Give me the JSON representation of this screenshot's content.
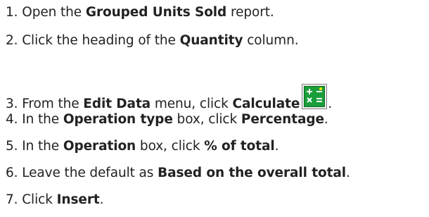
{
  "steps": [
    {
      "number": "1.",
      "parts": [
        {
          "t": "Open the "
        },
        {
          "t": "Grouped Units Sold",
          "b": true
        },
        {
          "t": " report."
        }
      ]
    },
    {
      "number": "2.",
      "parts": [
        {
          "t": "Click the heading of the "
        },
        {
          "t": "Quantity",
          "b": true
        },
        {
          "t": " column."
        }
      ]
    },
    {
      "number": "3.",
      "parts": [
        {
          "t": "From the "
        },
        {
          "t": "Edit Data",
          "b": true
        },
        {
          "t": " menu, click "
        },
        {
          "t": "Calculate",
          "b": true
        },
        {
          "icon": "calculate-icon"
        },
        {
          "t": "."
        }
      ]
    },
    {
      "number": "4.",
      "parts": [
        {
          "t": "In the "
        },
        {
          "t": "Operation type",
          "b": true
        },
        {
          "t": " box, click "
        },
        {
          "t": "Percentage",
          "b": true
        },
        {
          "t": "."
        }
      ]
    },
    {
      "number": "5.",
      "parts": [
        {
          "t": "In the "
        },
        {
          "t": "Operation",
          "b": true
        },
        {
          "t": " box, click "
        },
        {
          "t": "% of total",
          "b": true
        },
        {
          "t": "."
        }
      ]
    },
    {
      "number": "6.",
      "parts": [
        {
          "t": "Leave the default as "
        },
        {
          "t": "Based on the overall total",
          "b": true
        },
        {
          "t": "."
        }
      ]
    },
    {
      "number": "7.",
      "parts": [
        {
          "t": "Click "
        },
        {
          "t": "Insert",
          "b": true
        },
        {
          "t": "."
        }
      ]
    }
  ],
  "icon_colors": {
    "background": "#1a9e3a",
    "border": "#0b6b22",
    "glyph": "#ffffff",
    "spark": "#f2e600"
  }
}
